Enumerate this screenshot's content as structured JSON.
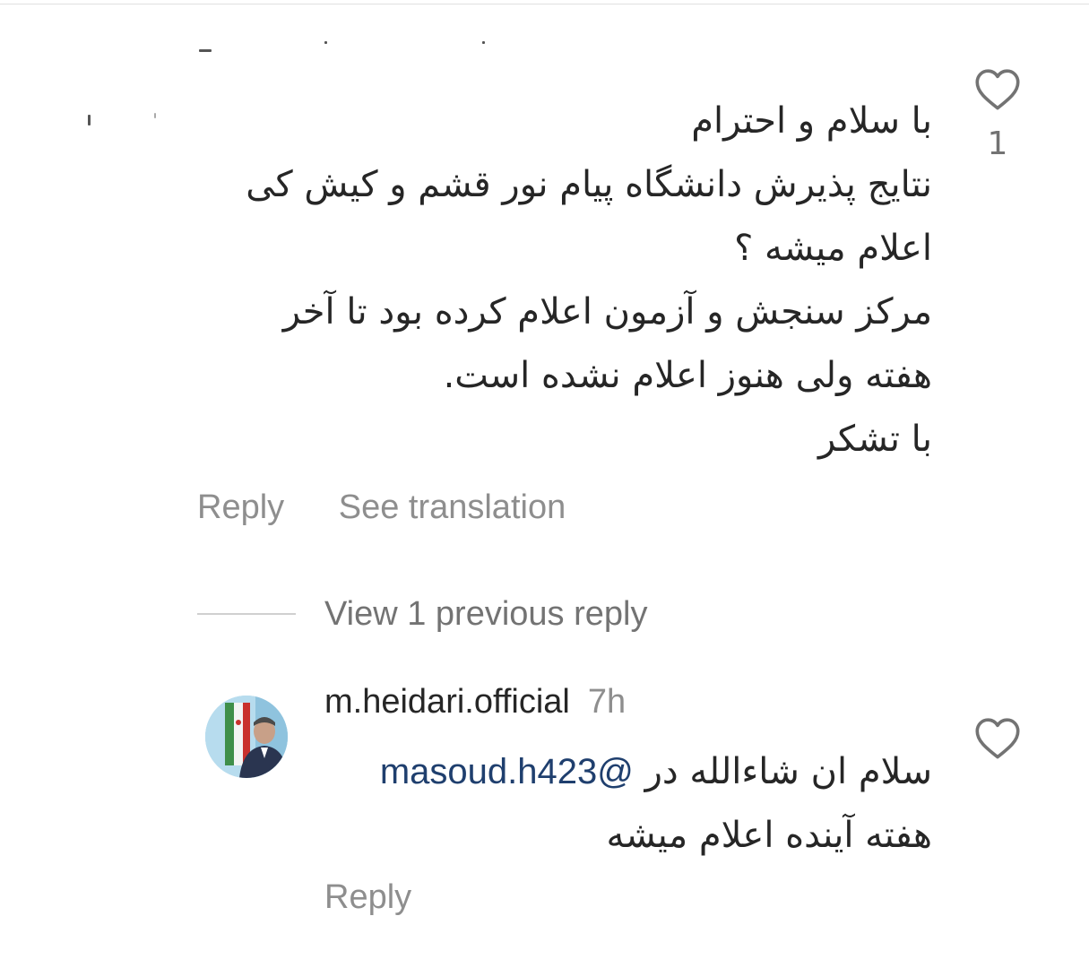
{
  "comment": {
    "lines": [
      "با سلام و احترام",
      "نتایج پذیرش دانشگاه پیام نور قشم و کیش کی",
      "اعلام میشه ؟",
      "مرکز سنجش و آزمون اعلام کرده بود تا آخر",
      "هفته ولی هنوز اعلام نشده است.",
      "با تشکر"
    ],
    "like_count": "1",
    "reply_label": "Reply",
    "translate_label": "See translation"
  },
  "view_replies_label": "View 1 previous reply",
  "reply": {
    "username": "m.heidari.official",
    "time": "7h",
    "mention": "@masoud.h423",
    "line1_text": "سلام ان شاءالله در",
    "line2": "هفته آینده اعلام میشه",
    "reply_label": "Reply"
  },
  "icons": {
    "like": "heart-outline-icon",
    "avatar": "profile-photo"
  },
  "colors": {
    "text": "#262626",
    "secondary": "#8e8e8e",
    "mention": "#1f3f6e"
  }
}
